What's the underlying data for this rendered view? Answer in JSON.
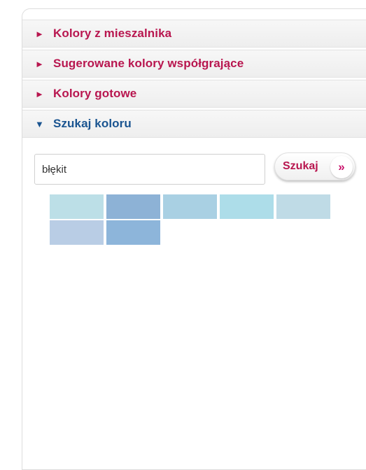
{
  "accordion": {
    "items": [
      {
        "arrow": "►",
        "label": "Kolory z mieszalnika",
        "state": "collapsed"
      },
      {
        "arrow": "►",
        "label": "Sugerowane kolory współgrające",
        "state": "collapsed"
      },
      {
        "arrow": "►",
        "label": "Kolory gotowe",
        "state": "collapsed"
      },
      {
        "arrow": "▼",
        "label": "Szukaj koloru",
        "state": "expanded"
      }
    ]
  },
  "search": {
    "value": "błękit",
    "button_label": "Szukaj",
    "button_icon": "»"
  },
  "swatches": [
    [
      "#bcdfe7",
      "#8db2d6",
      "#a9d0e3",
      "#addde9",
      "#bfdbe6"
    ],
    [
      "#b9cde5",
      "#8db5da"
    ]
  ],
  "colors": {
    "accent": "#b8164f",
    "expanded": "#1a5490"
  }
}
